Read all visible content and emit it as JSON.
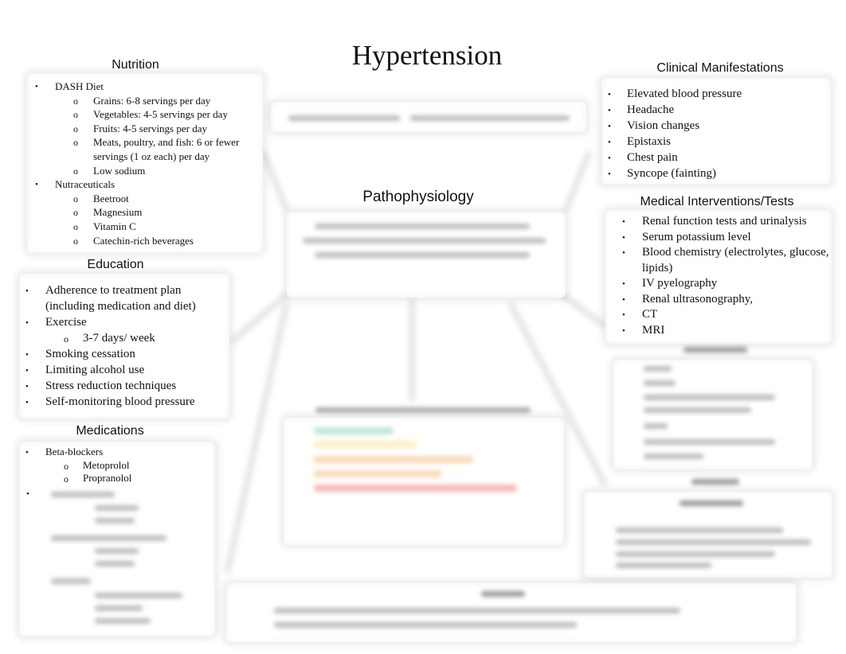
{
  "page": {
    "title": "Hypertension"
  },
  "nutrition": {
    "title": "Nutrition",
    "items": [
      {
        "label": "DASH Diet",
        "sub": [
          "Grains: 6-8 servings per day",
          "Vegetables: 4-5 servings per day",
          "Fruits: 4-5 servings per day",
          "Meats, poultry, and fish: 6 or fewer servings (1 oz each) per day",
          "Low sodium"
        ]
      },
      {
        "label": "Nutraceuticals",
        "sub": [
          "Beetroot",
          "Magnesium",
          "Vitamin C",
          "Catechin-rich beverages"
        ]
      }
    ]
  },
  "education": {
    "title": "Education",
    "items": [
      {
        "label": "Adherence to treatment plan (including medication and diet)"
      },
      {
        "label": "Exercise",
        "sub": [
          "3-7 days/ week"
        ]
      },
      {
        "label": "Smoking cessation"
      },
      {
        "label": "Limiting alcohol use"
      },
      {
        "label": "Stress reduction techniques"
      },
      {
        "label": "Self-monitoring blood pressure"
      }
    ]
  },
  "medications": {
    "title": "Medications",
    "items": [
      {
        "label": "Beta-blockers",
        "sub": [
          "Metoprolol",
          "Propranolol"
        ]
      }
    ],
    "obscured_note": "remaining content blurred"
  },
  "pathophysiology": {
    "title": "Pathophysiology"
  },
  "clinical_manifestations": {
    "title": "Clinical Manifestations",
    "items": [
      "Elevated blood pressure",
      "Headache",
      "Vision changes",
      "Epistaxis",
      "Chest pain",
      "Syncope (fainting)"
    ]
  },
  "medical_interventions": {
    "title": "Medical Interventions/Tests",
    "items": [
      "Renal function tests and urinalysis",
      "Serum potassium level",
      "Blood chemistry (electrolytes, glucose, lipids)",
      "IV pyelography",
      "Renal ultrasonography,",
      "CT",
      "MRI"
    ]
  },
  "colors": {
    "classification_green": "#bfe8d2",
    "classification_yellow": "#fdf0c4",
    "classification_orange": "#fbd9b8",
    "classification_red": "#f9b8b8",
    "box_shadow": "#e6e6e6"
  }
}
